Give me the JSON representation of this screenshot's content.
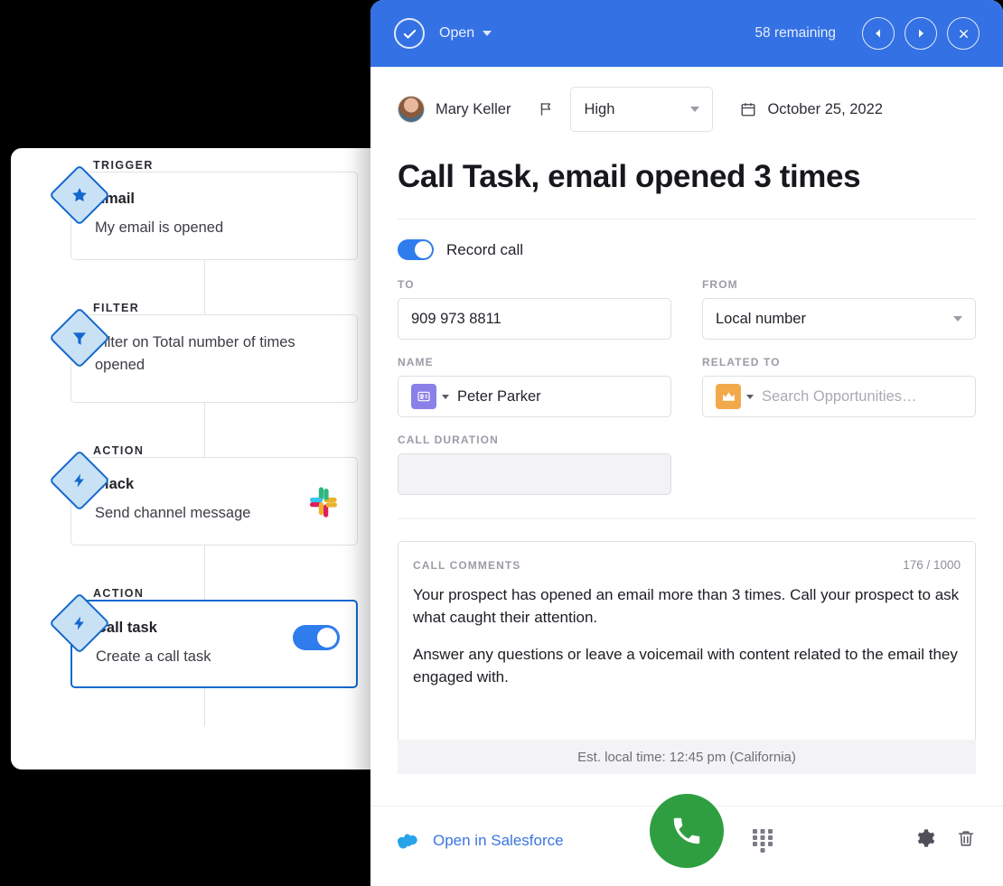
{
  "workflow": {
    "connector": "vertical-line",
    "steps": [
      {
        "kicker": "TRIGGER",
        "icon": "star-icon",
        "title": "Email",
        "subtitle": "My email is opened",
        "active": false
      },
      {
        "kicker": "FILTER",
        "icon": "funnel-icon",
        "title": "",
        "subtitle": "Filter on Total number of times opened",
        "active": false
      },
      {
        "kicker": "ACTION",
        "icon": "bolt-icon",
        "title": "Slack",
        "subtitle": "Send channel message",
        "active": false,
        "logo": "slack-logo"
      },
      {
        "kicker": "ACTION",
        "icon": "bolt-icon",
        "title": "Call task",
        "subtitle": "Create a call task",
        "active": true,
        "toggle_on": true
      }
    ]
  },
  "call_panel": {
    "header": {
      "check_icon": "check-circle-icon",
      "status": "Open",
      "status_caret": "chevron-down-icon",
      "remaining": "58 remaining",
      "prev_icon": "prev-arrow-icon",
      "next_icon": "next-arrow-icon",
      "close_icon": "close-icon"
    },
    "meta": {
      "avatar": "user-avatar",
      "owner": "Mary Keller",
      "flag_icon": "flag-icon",
      "priority": "High",
      "calendar_icon": "calendar-icon",
      "due_date": "October 25, 2022"
    },
    "title": "Call Task, email opened 3 times",
    "record_call": {
      "label": "Record call",
      "on": true
    },
    "fields": {
      "to": {
        "label": "TO",
        "value": "909 973 8811"
      },
      "from": {
        "label": "FROM",
        "value": "Local number"
      },
      "name": {
        "label": "NAME",
        "value": "Peter Parker",
        "icon": "contact-card-icon"
      },
      "related_to": {
        "label": "RELATED TO",
        "placeholder": "Search Opportunities…",
        "icon": "crown-icon"
      },
      "call_duration": {
        "label": "CALL DURATION",
        "value": ""
      }
    },
    "comments": {
      "label": "CALL COMMENTS",
      "counter": "176 / 1000",
      "paragraphs": [
        "Your prospect has opened an email more than 3 times. Call your prospect to ask what caught their attention.",
        "Answer any questions or leave a voicemail with content related to the email they engaged with."
      ]
    },
    "local_time": "Est. local time: 12:45 pm (California)",
    "actions": {
      "salesforce_icon": "salesforce-cloud-icon",
      "salesforce_link": "Open in Salesforce",
      "call_icon": "phone-icon",
      "dialpad_icon": "dialpad-icon",
      "settings_icon": "gear-icon",
      "delete_icon": "trash-icon"
    }
  },
  "colors": {
    "header_blue": "#3371e4",
    "accent_blue": "#2f7ced",
    "link_blue": "#3b74e0",
    "call_green": "#2f9e41",
    "card_border_active": "#1368ce",
    "diamond_fill": "#c9e1f5",
    "chip_purple": "#8b7fe8",
    "chip_orange": "#f2a94b",
    "page_background": "#000000"
  }
}
